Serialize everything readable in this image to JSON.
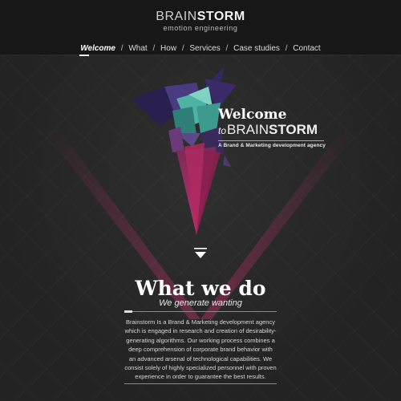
{
  "header": {
    "brand_light": "BRAIN",
    "brand_bold": "STORM",
    "tagline": "emotion engineering"
  },
  "nav": {
    "items": [
      {
        "label": "Welcome",
        "active": true
      },
      {
        "label": "What"
      },
      {
        "label": "How"
      },
      {
        "label": "Services"
      },
      {
        "label": "Case studies"
      },
      {
        "label": "Contact"
      }
    ],
    "separator": "/"
  },
  "hero": {
    "title": "Welcome",
    "to": "to",
    "brand_light": "BRAIN",
    "brand_bold": "STORM",
    "subtitle": "A Brand & Marketing development agency"
  },
  "what_we_do": {
    "title": "What we do",
    "subtitle": "We generate wanting",
    "body": "Brainstorm Is a Brand & Marketing development agency which is engaged in research and creation of desirability-generating algorithms. Our working process combines a deep comprehension of corporate brand behavior with an advanced arsenal of technological capabilities. We consist solely of highly specialized personnel with proven experience in order to guarantee the best results."
  },
  "colors": {
    "background": "#262626",
    "header_bg": "#171717",
    "accent_magenta": "#c0306a",
    "accent_teal": "#4fb3a3",
    "accent_purple": "#3a2a6a"
  },
  "icons": {
    "down_arrow": "triangle-down-icon"
  }
}
